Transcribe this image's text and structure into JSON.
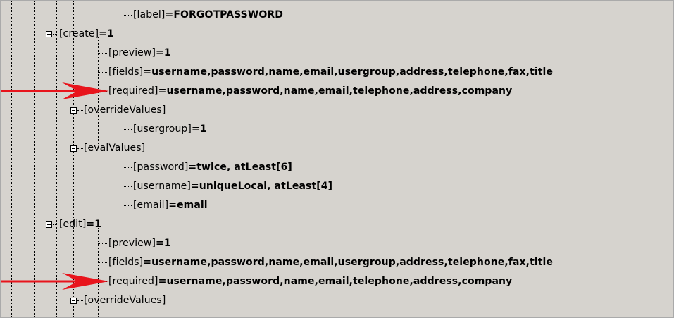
{
  "tree": [
    {
      "key": "label",
      "value": "FORGOTPASSWORD"
    },
    {
      "key": "create",
      "value": "1"
    },
    {
      "key": "preview",
      "value": "1"
    },
    {
      "key": "fields",
      "value": "username,password,name,email,usergroup,address,telephone,fax,title"
    },
    {
      "key": "required",
      "value": "username,password,name,email,telephone,address,company"
    },
    {
      "key": "overrideValues",
      "value": ""
    },
    {
      "key": "usergroup",
      "value": "1"
    },
    {
      "key": "evalValues",
      "value": ""
    },
    {
      "key": "password",
      "value": "twice, atLeast[6]"
    },
    {
      "key": "username",
      "value": "uniqueLocal, atLeast[4]"
    },
    {
      "key": "email",
      "value": "email"
    },
    {
      "key": "edit",
      "value": "1"
    },
    {
      "key": "preview",
      "value": "1"
    },
    {
      "key": "fields",
      "value": "username,password,name,email,usergroup,address,telephone,fax,title"
    },
    {
      "key": "required",
      "value": "username,password,name,email,telephone,address,company"
    },
    {
      "key": "overrideValues",
      "value": ""
    }
  ],
  "colors": {
    "background": "#d6d3ce",
    "arrow": "#e8141c"
  }
}
